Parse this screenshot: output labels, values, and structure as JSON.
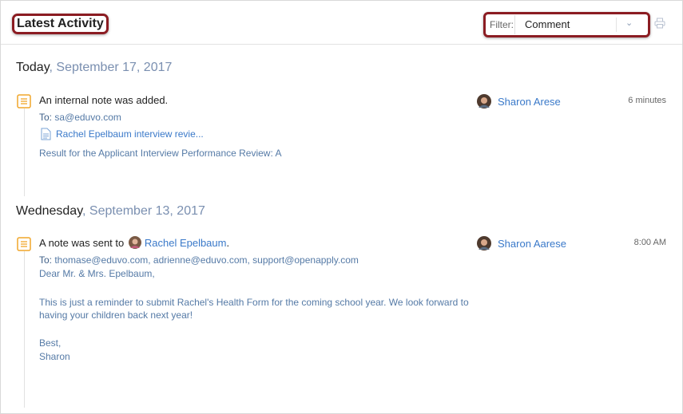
{
  "header": {
    "title": "Latest Activity",
    "filter_label": "Filter:",
    "filter_value": "Comment",
    "print_icon": "printer-icon"
  },
  "days": [
    {
      "weekday": "Today",
      "date": ", September 17, 2017",
      "entry": {
        "icon": "note-icon",
        "title": "An internal note was added.",
        "to_label": "To:",
        "to_value": " sa@eduvo.com",
        "attachment": "Rachel Epelbaum interview revie...",
        "result": "Result for the Applicant Interview Performance Review:  A",
        "author": "Sharon Arese",
        "time": "6 minutes"
      }
    },
    {
      "weekday": "Wednesday",
      "date": ", September 13, 2017",
      "entry": {
        "icon": "note-icon",
        "title_prefix": "A note was sent to ",
        "recipient": "Rachel Epelbaum",
        "title_suffix": ".",
        "to_label": "To:",
        "to_value": " thomase@eduvo.com, adrienne@eduvo.com, support@openapply.com",
        "greeting": "Dear Mr. & Mrs. Epelbaum,",
        "body_line1": "This is just a reminder to submit Rachel's Health Form for the coming school year. We look forward to",
        "body_line2": "having your children back next year!",
        "signoff1": "Best,",
        "signoff2": "Sharon",
        "author": "Sharon Aarese",
        "time": "8:00 AM"
      }
    }
  ],
  "colors": {
    "highlight": "#8b1c22",
    "link": "#3a79c9",
    "muted_text": "#557aa6",
    "icon_orange": "#f0a62a"
  }
}
